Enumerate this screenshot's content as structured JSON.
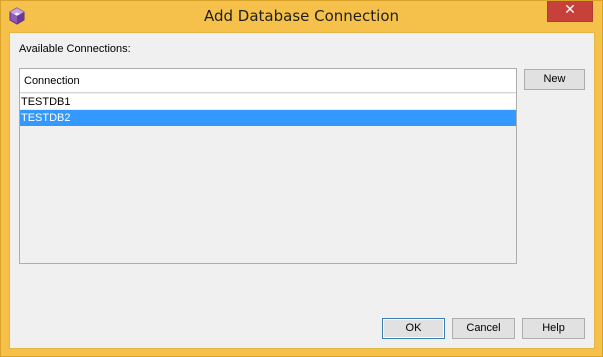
{
  "window": {
    "title": "Add Database Connection",
    "close_label": "✕",
    "icon": "netbeans-cube-icon"
  },
  "dialog": {
    "available_label": "Available Connections:",
    "list": {
      "header": "Connection",
      "rows": [
        {
          "label": "TESTDB1",
          "selected": false
        },
        {
          "label": "TESTDB2",
          "selected": true
        }
      ]
    },
    "buttons": {
      "new": "New",
      "ok": "OK",
      "cancel": "Cancel",
      "help": "Help"
    }
  },
  "colors": {
    "titlebar": "#f5c14a",
    "selection": "#3399ff",
    "close": "#c7403a"
  }
}
